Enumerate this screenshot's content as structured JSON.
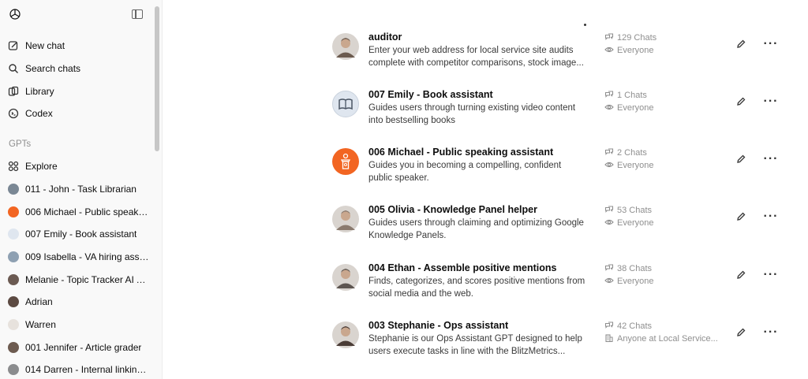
{
  "sidebar": {
    "nav": [
      {
        "label": "New chat",
        "icon": "new-chat-icon"
      },
      {
        "label": "Search chats",
        "icon": "search-icon"
      },
      {
        "label": "Library",
        "icon": "library-icon"
      },
      {
        "label": "Codex",
        "icon": "codex-icon"
      }
    ],
    "section_label": "GPTs",
    "explore_label": "Explore",
    "gpts": [
      {
        "label": "011 - John - Task Librarian",
        "color": "#7a8794"
      },
      {
        "label": "006 Michael - Public speakin...",
        "color": "#f26522"
      },
      {
        "label": "007 Emily - Book assistant",
        "color": "#dfe6ef"
      },
      {
        "label": "009 Isabella - VA hiring assis...",
        "color": "#8ea0b2"
      },
      {
        "label": "Melanie - Topic Tracker AI A...",
        "color": "#6b5a52"
      },
      {
        "label": "Adrian",
        "color": "#5c4a42"
      },
      {
        "label": "Warren",
        "color": "#e7e2dd"
      },
      {
        "label": "001 Jennifer - Article grader",
        "color": "#6d5b50"
      },
      {
        "label": "014 Darren - Internal linking...",
        "color": "#8b8c8e"
      }
    ]
  },
  "gpt_list": [
    {
      "title": "auditor",
      "desc": "Enter your web address for local service site audits complete with competitor comparisons, stock image...",
      "chats": "129 Chats",
      "visibility": "Everyone",
      "avatar": "person",
      "avatar_color": "#6b5a4e"
    },
    {
      "title": "007 Emily - Book assistant",
      "desc": "Guides users through turning existing video content into bestselling books",
      "chats": "1 Chats",
      "visibility": "Everyone",
      "avatar": "book",
      "avatar_color": "#dfe6ef"
    },
    {
      "title": "006 Michael - Public speaking assistant",
      "desc": "Guides you in becoming a compelling, confident public speaker.",
      "chats": "2 Chats",
      "visibility": "Everyone",
      "avatar": "podium",
      "avatar_color": "#f26522"
    },
    {
      "title": "005 Olivia - Knowledge Panel helper",
      "desc": "Guides users through claiming and optimizing Google Knowledge Panels.",
      "chats": "53 Chats",
      "visibility": "Everyone",
      "avatar": "person",
      "avatar_color": "#8a7a6e"
    },
    {
      "title": "004 Ethan - Assemble positive mentions",
      "desc": "Finds, categorizes, and scores positive mentions from social media and the web.",
      "chats": "38 Chats",
      "visibility": "Everyone",
      "avatar": "person",
      "avatar_color": "#5d5550"
    },
    {
      "title": "003 Stephanie - Ops assistant",
      "desc": "Stephanie is our Ops Assistant GPT designed to help users execute tasks in line with the BlitzMetrics...",
      "chats": "42 Chats",
      "visibility": "Anyone at Local Service...",
      "avatar": "person",
      "avatar_color": "#4a3c36"
    }
  ]
}
